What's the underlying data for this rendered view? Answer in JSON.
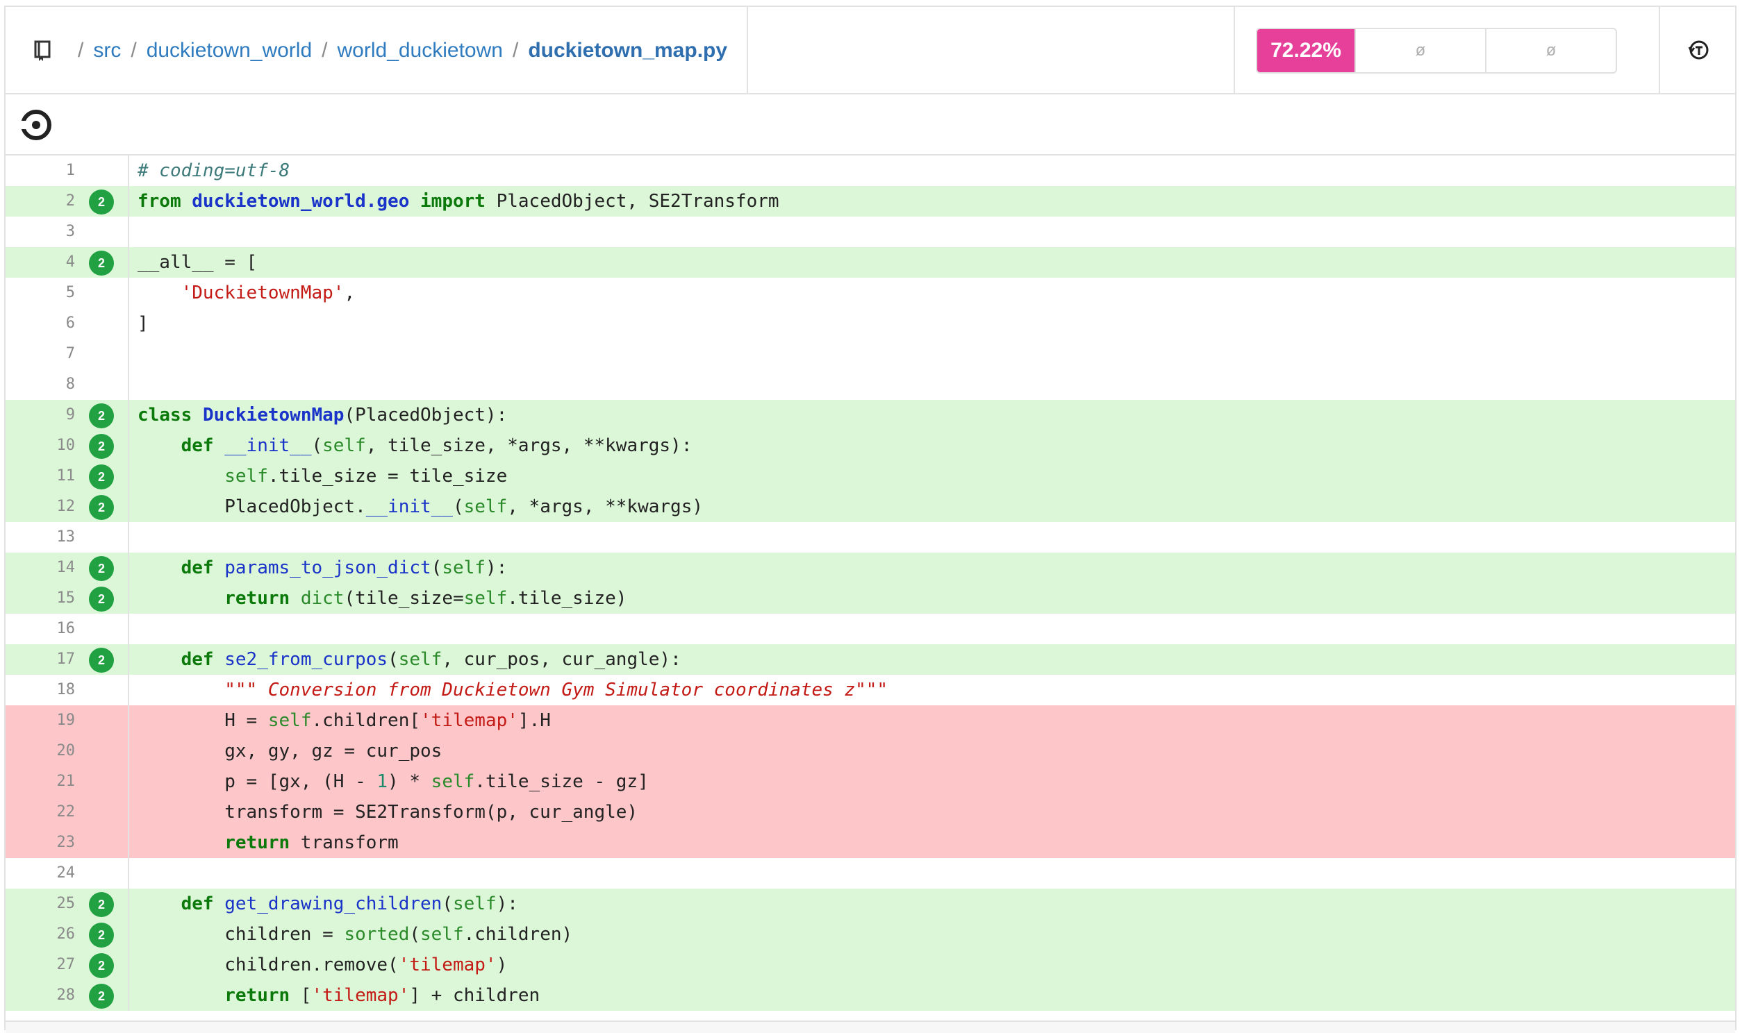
{
  "breadcrumb": {
    "parts": [
      "src",
      "duckietown_world",
      "world_duckietown"
    ],
    "file": "duckietown_map.py",
    "separator": "/"
  },
  "coverage": {
    "percent": "72.22%",
    "cell_a": "ø",
    "cell_b": "ø",
    "accent_color": "#e7409a"
  },
  "icons": {
    "repo": "repo-icon",
    "history": "history-icon",
    "ci": "circleci-icon"
  },
  "lines": [
    {
      "n": "1",
      "hits": "",
      "status": "none"
    },
    {
      "n": "2",
      "hits": "2",
      "status": "hit"
    },
    {
      "n": "3",
      "hits": "",
      "status": "none"
    },
    {
      "n": "4",
      "hits": "2",
      "status": "hit"
    },
    {
      "n": "5",
      "hits": "",
      "status": "none"
    },
    {
      "n": "6",
      "hits": "",
      "status": "none"
    },
    {
      "n": "7",
      "hits": "",
      "status": "none"
    },
    {
      "n": "8",
      "hits": "",
      "status": "none"
    },
    {
      "n": "9",
      "hits": "2",
      "status": "hit"
    },
    {
      "n": "10",
      "hits": "2",
      "status": "hit"
    },
    {
      "n": "11",
      "hits": "2",
      "status": "hit"
    },
    {
      "n": "12",
      "hits": "2",
      "status": "hit"
    },
    {
      "n": "13",
      "hits": "",
      "status": "none"
    },
    {
      "n": "14",
      "hits": "2",
      "status": "hit"
    },
    {
      "n": "15",
      "hits": "2",
      "status": "hit"
    },
    {
      "n": "16",
      "hits": "",
      "status": "none"
    },
    {
      "n": "17",
      "hits": "2",
      "status": "hit"
    },
    {
      "n": "18",
      "hits": "",
      "status": "none"
    },
    {
      "n": "19",
      "hits": "",
      "status": "miss"
    },
    {
      "n": "20",
      "hits": "",
      "status": "miss"
    },
    {
      "n": "21",
      "hits": "",
      "status": "miss"
    },
    {
      "n": "22",
      "hits": "",
      "status": "miss"
    },
    {
      "n": "23",
      "hits": "",
      "status": "miss"
    },
    {
      "n": "24",
      "hits": "",
      "status": "none"
    },
    {
      "n": "25",
      "hits": "2",
      "status": "hit"
    },
    {
      "n": "26",
      "hits": "2",
      "status": "hit"
    },
    {
      "n": "27",
      "hits": "2",
      "status": "hit"
    },
    {
      "n": "28",
      "hits": "2",
      "status": "hit"
    }
  ],
  "code": {
    "l1": "# coding=utf-8",
    "l2_from": "from",
    "l2_mod": "duckietown_world.geo",
    "l2_import": "import",
    "l2_rest": " PlacedObject, SE2Transform",
    "l4": "__all__ = [",
    "l5_str": "'DuckietownMap'",
    "l5_rest": ",",
    "l6": "]",
    "l9_class": "class",
    "l9_name": "DuckietownMap",
    "l9_rest": "(PlacedObject):",
    "l10_def": "def",
    "l10_name": "__init__",
    "l10_open": "(",
    "l10_self": "self",
    "l10_rest": ", tile_size, *args, **kwargs):",
    "l11_self": "self",
    "l11_rest": ".tile_size = tile_size",
    "l12_a": "PlacedObject.",
    "l12_name": "__init__",
    "l12_open": "(",
    "l12_self": "self",
    "l12_rest": ", *args, **kwargs)",
    "l14_def": "def",
    "l14_name": "params_to_json_dict",
    "l14_open": "(",
    "l14_self": "self",
    "l14_rest": "):",
    "l15_return": "return",
    "l15_dict": "dict",
    "l15_mid": "(tile_size=",
    "l15_self": "self",
    "l15_rest": ".tile_size)",
    "l17_def": "def",
    "l17_name": "se2_from_curpos",
    "l17_open": "(",
    "l17_self": "self",
    "l17_rest": ", cur_pos, cur_angle):",
    "l18": "\"\"\" Conversion from Duckietown Gym Simulator coordinates z\"\"\"",
    "l19_a": "H = ",
    "l19_self": "self",
    "l19_b": ".children[",
    "l19_str": "'tilemap'",
    "l19_c": "].H",
    "l20": "gx, gy, gz = cur_pos",
    "l21_a": "p = [gx, (H - ",
    "l21_num": "1",
    "l21_b": ") * ",
    "l21_self": "self",
    "l21_c": ".tile_size - gz]",
    "l22": "transform = SE2Transform(p, cur_angle)",
    "l23_return": "return",
    "l23_rest": " transform",
    "l25_def": "def",
    "l25_name": "get_drawing_children",
    "l25_open": "(",
    "l25_self": "self",
    "l25_rest": "):",
    "l26_a": "children = ",
    "l26_sorted": "sorted",
    "l26_b": "(",
    "l26_self": "self",
    "l26_c": ".children)",
    "l27_a": "children.remove(",
    "l27_str": "'tilemap'",
    "l27_b": ")",
    "l28_return": "return",
    "l28_a": " [",
    "l28_str": "'tilemap'",
    "l28_b": "] + children"
  }
}
